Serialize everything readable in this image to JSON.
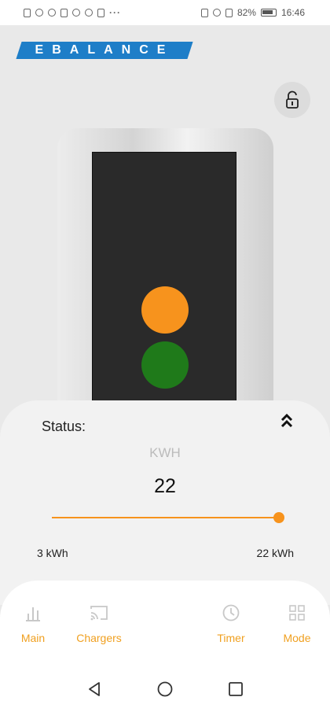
{
  "status_bar": {
    "battery": "82%",
    "time": "16:46",
    "icons": [
      "sim-icon",
      "wifi-icon",
      "bluetooth-icon",
      "usb-icon",
      "whatsapp-icon",
      "sync-icon",
      "app-icon",
      "more-dots-icon",
      "nfc-icon",
      "bluetooth-icon",
      "mute-icon",
      "battery-icon"
    ],
    "more_dots": "···"
  },
  "logo": {
    "text": "EBALANCE",
    "color": "#1e7ec8"
  },
  "lock_button": {
    "icon": "unlock-icon"
  },
  "charger": {
    "lights": [
      {
        "name": "amber",
        "color": "#f7931d"
      },
      {
        "name": "green",
        "color": "#1f7a1a"
      }
    ]
  },
  "sheet": {
    "status_label": "Status:",
    "unit_label": "KWH",
    "value": "22",
    "slider": {
      "min": 3,
      "max": 22,
      "value": 22,
      "min_label": "3 kWh",
      "max_label": "22 kWh"
    },
    "accent": "#f7931d"
  },
  "nav": {
    "items": [
      {
        "label": "Main",
        "icon": "bar-chart-icon"
      },
      {
        "label": "Chargers",
        "icon": "cast-icon"
      },
      {
        "label": "Timer",
        "icon": "clock-icon"
      },
      {
        "label": "Mode",
        "icon": "grid-icon"
      }
    ],
    "color": "#f0a020"
  },
  "system_nav": {
    "buttons": [
      "back-icon",
      "home-icon",
      "recents-icon"
    ]
  }
}
